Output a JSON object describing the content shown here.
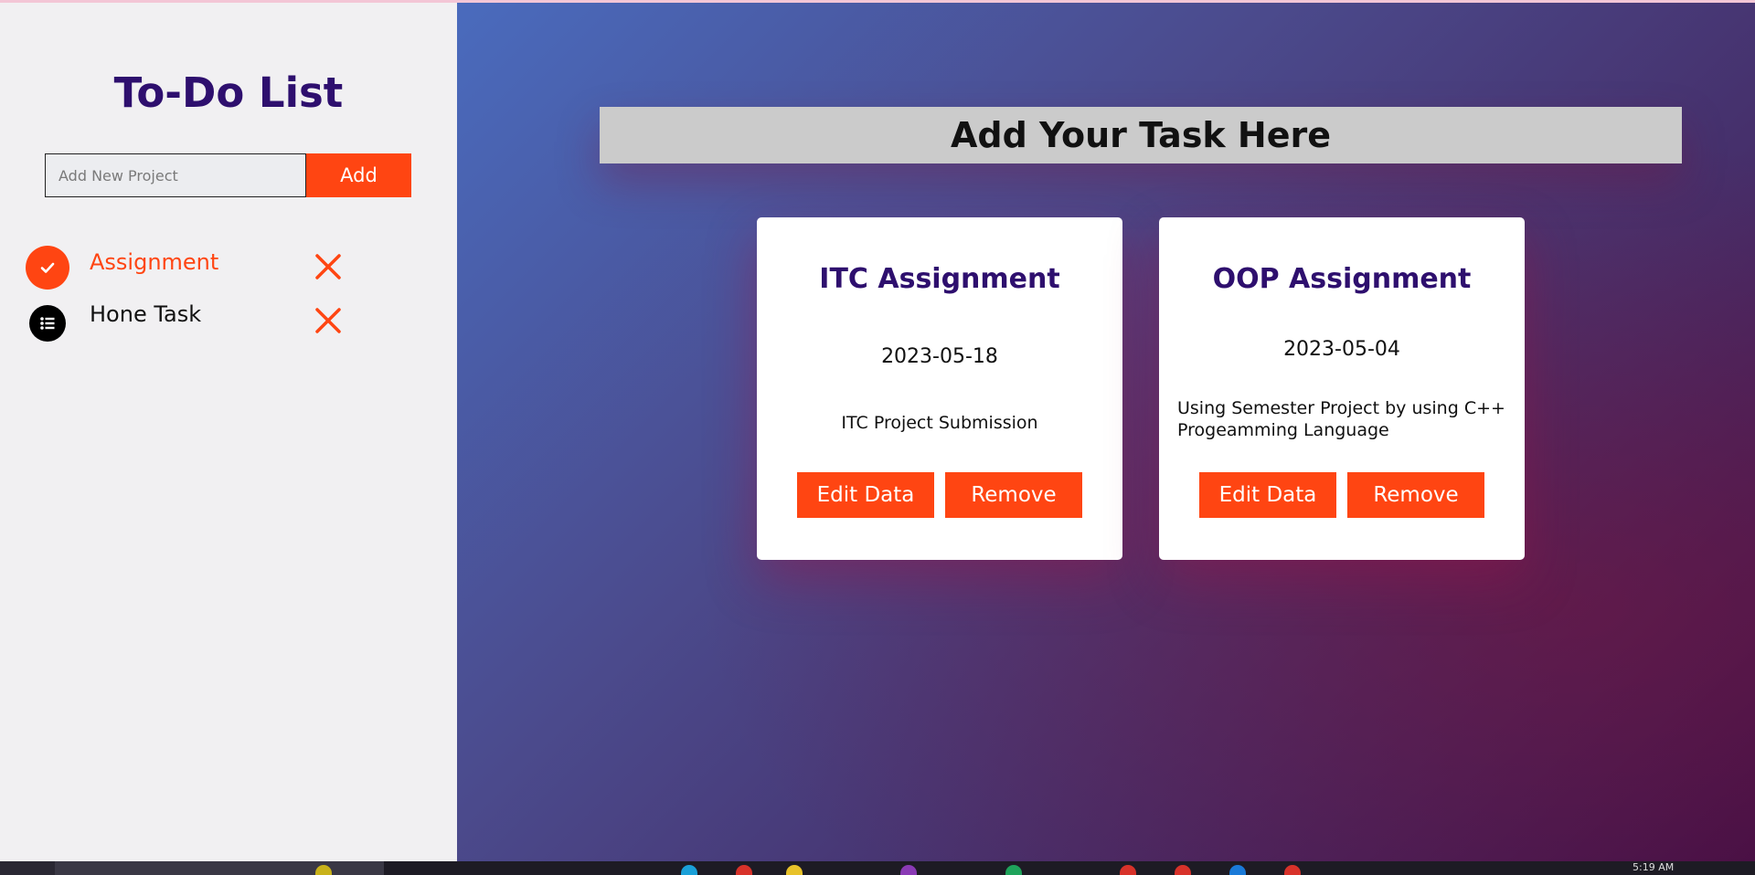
{
  "sidebar": {
    "title": "To-Do List",
    "input_placeholder": "Add New Project",
    "add_label": "Add",
    "projects": [
      {
        "label": "Assignment",
        "icon": "check-icon",
        "active": true
      },
      {
        "label": "Hone Task",
        "icon": "list-icon",
        "active": false
      }
    ]
  },
  "main": {
    "banner": "Add Your Task Here",
    "tasks": [
      {
        "title": "ITC Assignment",
        "date": "2023-05-18",
        "description": "ITC Project Submission",
        "edit_label": "Edit Data",
        "remove_label": "Remove"
      },
      {
        "title": "OOP Assignment",
        "date": "2023-05-04",
        "description": "Using Semester Project by using C++ Progeamming Language",
        "edit_label": "Edit Data",
        "remove_label": "Remove"
      }
    ]
  },
  "taskbar": {
    "clock": "5:19 AM"
  },
  "colors": {
    "accent": "#ff4512",
    "title": "#2e0f6e",
    "sidebar_bg": "#f1f0f2",
    "banner_bg": "#cbcbcb"
  }
}
